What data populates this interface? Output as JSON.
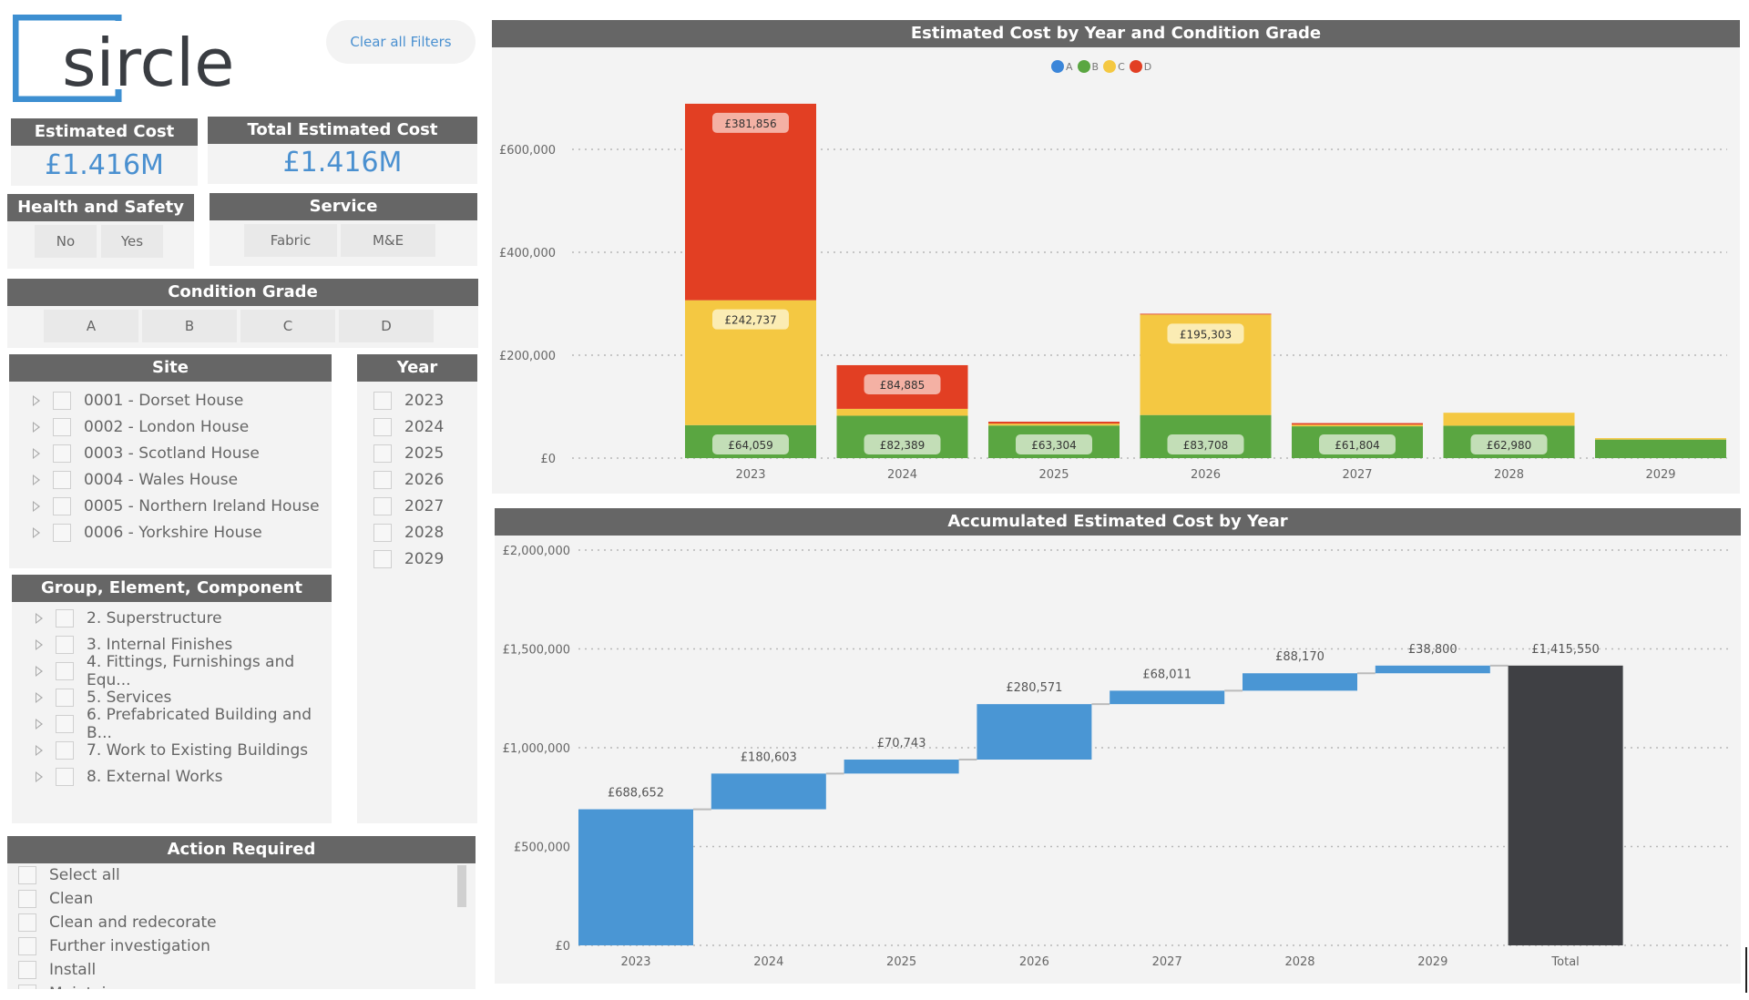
{
  "logo": {
    "text": "sircle",
    "bracket_color": "#3d8fd1",
    "text_color": "#3a3d42"
  },
  "clear_filters_label": "Clear all Filters",
  "kpis": [
    {
      "title": "Estimated Cost",
      "value": "£1.416M"
    },
    {
      "title": "Total Estimated Cost",
      "value": "£1.416M"
    }
  ],
  "health_safety": {
    "title": "Health and Safety",
    "options": [
      "No",
      "Yes"
    ]
  },
  "service": {
    "title": "Service",
    "options": [
      "Fabric",
      "M&E"
    ]
  },
  "condition_grade": {
    "title": "Condition Grade",
    "options": [
      "A",
      "B",
      "C",
      "D"
    ]
  },
  "site": {
    "title": "Site",
    "items": [
      "0001 - Dorset House",
      "0002 - London House",
      "0003 - Scotland House",
      "0004 - Wales House",
      "0005 - Northern Ireland House",
      "0006 - Yorkshire House"
    ]
  },
  "year": {
    "title": "Year",
    "items": [
      "2023",
      "2024",
      "2025",
      "2026",
      "2027",
      "2028",
      "2029"
    ]
  },
  "group": {
    "title": "Group, Element, Component",
    "items": [
      "2. Superstructure",
      "3. Internal Finishes",
      "4. Fittings, Furnishings and Equ...",
      "5. Services",
      "6. Prefabricated Building and B...",
      "7. Work to Existing Buildings",
      "8. External Works"
    ]
  },
  "action_required": {
    "title": "Action Required",
    "items": [
      "Select all",
      "Clean",
      "Clean and redecorate",
      "Further investigation",
      "Install",
      "Maintain"
    ]
  },
  "colors": {
    "A": "#3b86d9",
    "B": "#5aa641",
    "C": "#f4c842",
    "D": "#e23f23",
    "waterfall": "#4a96d4",
    "total": "#3f4044"
  },
  "chart_data": [
    {
      "type": "bar",
      "stacked": true,
      "title": "Estimated Cost by Year and Condition Grade",
      "categories": [
        "2023",
        "2024",
        "2025",
        "2026",
        "2027",
        "2028",
        "2029"
      ],
      "series": [
        {
          "name": "A",
          "values": [
            0,
            0,
            0,
            0,
            0,
            0,
            0
          ]
        },
        {
          "name": "B",
          "values": [
            64059,
            82389,
            63304,
            83708,
            61804,
            62980,
            36000
          ]
        },
        {
          "name": "C",
          "values": [
            242737,
            13329,
            3700,
            195303,
            3100,
            25190,
            2800
          ]
        },
        {
          "name": "D",
          "values": [
            381856,
            84885,
            3739,
            1560,
            3107,
            0,
            0
          ]
        }
      ],
      "data_labels": [
        {
          "category": "2023",
          "series": "B",
          "text": "£64,059"
        },
        {
          "category": "2023",
          "series": "C",
          "text": "£242,737"
        },
        {
          "category": "2023",
          "series": "D",
          "text": "£381,856"
        },
        {
          "category": "2024",
          "series": "B",
          "text": "£82,389"
        },
        {
          "category": "2024",
          "series": "D",
          "text": "£84,885"
        },
        {
          "category": "2025",
          "series": "B",
          "text": "£63,304"
        },
        {
          "category": "2026",
          "series": "B",
          "text": "£83,708"
        },
        {
          "category": "2026",
          "series": "C",
          "text": "£195,303"
        },
        {
          "category": "2027",
          "series": "B",
          "text": "£61,804"
        },
        {
          "category": "2028",
          "series": "B",
          "text": "£62,980"
        }
      ],
      "legend": [
        "A",
        "B",
        "C",
        "D"
      ],
      "legend_position": "top-center",
      "yticks": [
        "£0",
        "£200,000",
        "£400,000",
        "£600,000"
      ],
      "ytick_values": [
        0,
        200000,
        400000,
        600000
      ],
      "ylim": [
        0,
        690000
      ],
      "xlabel": "",
      "ylabel": "",
      "grid": true
    },
    {
      "type": "waterfall",
      "title": "Accumulated Estimated Cost by Year",
      "categories": [
        "2023",
        "2024",
        "2025",
        "2026",
        "2027",
        "2028",
        "2029",
        "Total"
      ],
      "values": [
        688652,
        180603,
        70743,
        280571,
        68011,
        88170,
        38800,
        1415550
      ],
      "labels": [
        "£688,652",
        "£180,603",
        "£70,743",
        "£280,571",
        "£68,011",
        "£88,170",
        "£38,800",
        "£1,415,550"
      ],
      "yticks": [
        "£0",
        "£500,000",
        "£1,000,000",
        "£1,500,000",
        "£2,000,000"
      ],
      "ytick_values": [
        0,
        500000,
        1000000,
        1500000,
        2000000
      ],
      "ylim": [
        0,
        2000000
      ],
      "xlabel": "",
      "ylabel": "",
      "grid": true
    }
  ]
}
